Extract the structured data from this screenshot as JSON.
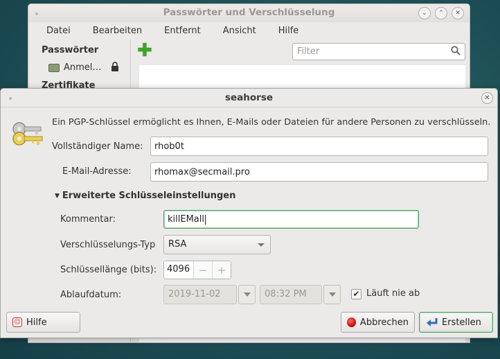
{
  "bg_window": {
    "title": "Passwörter und Verschlüsselung",
    "menu": [
      "Datei",
      "Bearbeiten",
      "Entfernt",
      "Ansicht",
      "Hilfe"
    ],
    "sidebar": {
      "heading": "Passwörter",
      "item": "Anmel…",
      "heading2": "Zertifikate"
    },
    "filter_placeholder": "Filter"
  },
  "dialog": {
    "title": "seahorse",
    "description": "Ein PGP-Schlüssel ermöglicht es Ihnen, E-Mails oder Dateien für andere Personen zu verschlüsseln.",
    "name_label": "Vollständiger Name:",
    "name_value": "rhob0t",
    "email_label": "E-Mail-Adresse:",
    "email_value": "rhomax@secmail.pro",
    "advanced_label": "Erweiterte Schlüsseleinstellungen",
    "comment_label": "Kommentar:",
    "comment_value": "killEMall",
    "enc_type_label": "Verschlüsselungs-Typ",
    "enc_type_value": "RSA",
    "key_length_label": "Schlüssellänge (bits):",
    "key_length_value": "4096",
    "expiry_label": "Ablaufdatum:",
    "expiry_date": "2019-11-02",
    "expiry_time": "08:32 PM",
    "never_expires_label": "Läuft nie ab",
    "never_expires_checked": true,
    "help_button": "Hilfe",
    "cancel_button": "Abbrechen",
    "create_button": "Erstellen"
  }
}
